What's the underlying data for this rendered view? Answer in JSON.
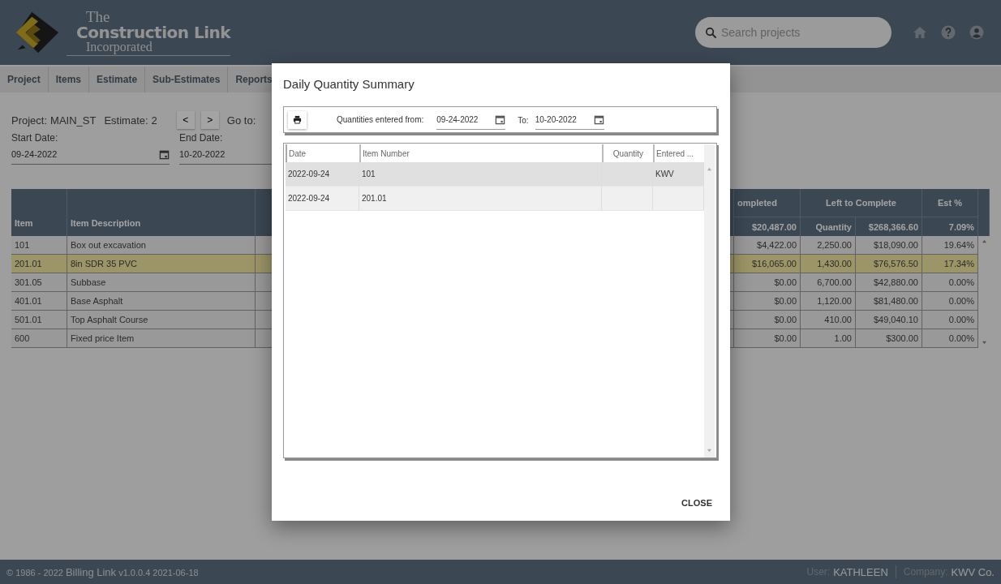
{
  "header": {
    "logo": {
      "line_1": "The",
      "line_2": "Construction Link",
      "line_3": "Incorporated"
    },
    "search": {
      "placeholder": "Search projects"
    }
  },
  "nav": [
    {
      "label": "Project"
    },
    {
      "label": "Items"
    },
    {
      "label": "Estimate"
    },
    {
      "label": "Sub-Estimates"
    },
    {
      "label": "Reports"
    }
  ],
  "project_bar": {
    "project_label": "Project:",
    "project": "MAIN_ST",
    "estimate_label": "Estimate:",
    "estimate": "2",
    "prev": "<",
    "next": ">",
    "goto_label": "Go to:"
  },
  "dates": {
    "start_label": "Start Date:",
    "start": "09-24-2022",
    "end_label": "End Date:",
    "end": "10-20-2022"
  },
  "estimate_table": {
    "group_headers": [
      "ompleted",
      "Left to Complete",
      "Est %"
    ],
    "columns": [
      "Item",
      "Item Description"
    ],
    "totals": [
      "$20,487.00",
      "Quantity",
      "$268,366.60",
      "7.09%"
    ],
    "rows": [
      {
        "item": "101",
        "description": "Box out excavation",
        "completed_amount": "$4,422.00",
        "left_quantity": "2,250.00",
        "left_amount": "$18,090.00",
        "est_pct": "19.64%",
        "selected": false
      },
      {
        "item": "201.01",
        "description": "8in SDR 35 PVC",
        "completed_amount": "$16,065.00",
        "left_quantity": "1,430.00",
        "left_amount": "$76,576.50",
        "est_pct": "17.34%",
        "selected": true
      },
      {
        "item": "301.05",
        "description": "Subbase",
        "completed_amount": "$0.00",
        "left_quantity": "6,700.00",
        "left_amount": "$42,880.00",
        "est_pct": "0.00%",
        "selected": false
      },
      {
        "item": "401.01",
        "description": "Base Asphalt",
        "completed_amount": "$0.00",
        "left_quantity": "1,120.00",
        "left_amount": "$81,480.00",
        "est_pct": "0.00%",
        "selected": false
      },
      {
        "item": "501.01",
        "description": "Top Asphalt Course",
        "completed_amount": "$0.00",
        "left_quantity": "410.00",
        "left_amount": "$49,040.10",
        "est_pct": "0.00%",
        "selected": false
      },
      {
        "item": "600",
        "description": "Fixed price Item",
        "completed_amount": "$0.00",
        "left_quantity": "1.00",
        "left_amount": "$300.00",
        "est_pct": "0.00%",
        "selected": false
      }
    ]
  },
  "dialog": {
    "title": "Daily Quantity Summary",
    "from_label": "Quantities entered from:",
    "from": "09-24-2022",
    "to_label": "To:",
    "to": "10-20-2022",
    "columns": [
      "Date",
      "Item Number",
      "Quantity",
      "Entered ..."
    ],
    "rows": [
      {
        "date": "2022-09-24",
        "item_number": "101",
        "entered_by": "KWV",
        "selected": true
      },
      {
        "date": "2022-09-24",
        "item_number": "201.01",
        "selected": false
      }
    ],
    "close": "CLOSE"
  },
  "footer": {
    "copyright": "© 1986 - 2022",
    "app": "Billing Link",
    "version": "v1.0.0.4 2021-06-18",
    "user_label": "User:",
    "user": "KATHLEEN",
    "company_label": "Company:",
    "company": "KWV Co."
  }
}
